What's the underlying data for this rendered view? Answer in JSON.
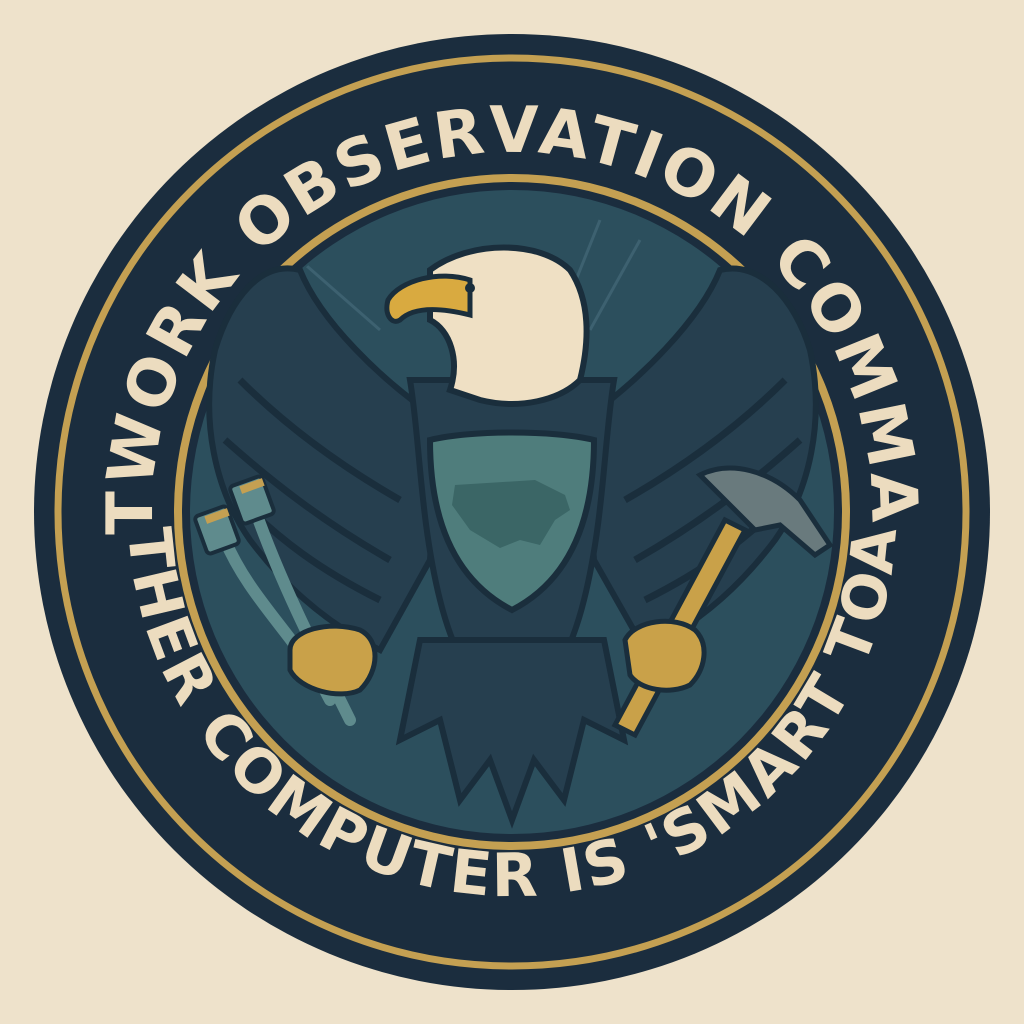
{
  "seal": {
    "top_text": "NETWORK OBSERVATION COMMAND",
    "bottom_text": "MY OTHER COMPUTER IS 'SMART TOASTER"
  },
  "colors": {
    "background": "#eee2cb",
    "navy_ring": "#1b2d3e",
    "gold": "#c4a052",
    "cream_text": "#ecdcbf",
    "inner_field": "#2c4f5d",
    "eagle_body": "#263f4f",
    "eagle_dark": "#1a2e3c",
    "eagle_head": "#efe0c4",
    "beak": "#d9aa40",
    "shield": "#4f7d7c",
    "map": "#3b6666",
    "cable": "#5f8b8d",
    "hammer_head": "#697a7d",
    "hammer_handle": "#c9a149"
  },
  "icons": {
    "emblem": "eagle-icon",
    "shield": "shield-icon",
    "map": "usa-map-icon",
    "left_claw_item": "ethernet-cable-icon",
    "right_claw_item": "hammer-icon"
  }
}
